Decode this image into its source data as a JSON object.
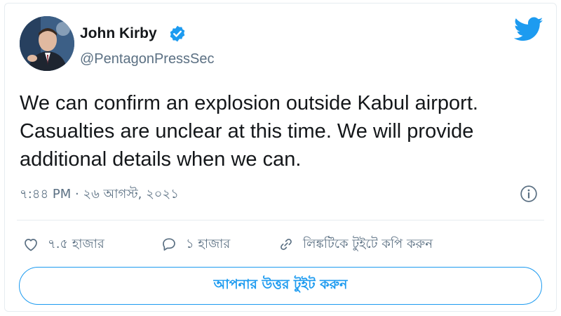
{
  "author": {
    "name": "John Kirby",
    "handle": "@PentagonPressSec",
    "verified": true,
    "avatar": "profile-photo"
  },
  "tweet": {
    "text": "We can confirm an explosion outside Kabul airport.\nCasualties are unclear at this time.  We will provide\nadditional details when we can.",
    "timestamp": "৭:৪৪ PM · ২৬ আগস্ট, ২০২১"
  },
  "actions": {
    "likes_label": "৭.৫ হাজার",
    "replies_label": "১ হাজার",
    "copy_link_label": "লিঙ্কটিকে টুইটে কপি করুন"
  },
  "reply_button": {
    "label": "আপনার উত্তর টুইট করুন"
  },
  "icons": {
    "brand": "twitter-bird-icon",
    "verified": "verified-badge-icon",
    "info": "info-icon",
    "like": "heart-icon",
    "reply": "speech-bubble-icon",
    "link": "link-icon"
  },
  "colors": {
    "accent": "#1d9bf0",
    "text": "#14171a",
    "secondary": "#5b7083",
    "border": "#e6ecf0"
  }
}
